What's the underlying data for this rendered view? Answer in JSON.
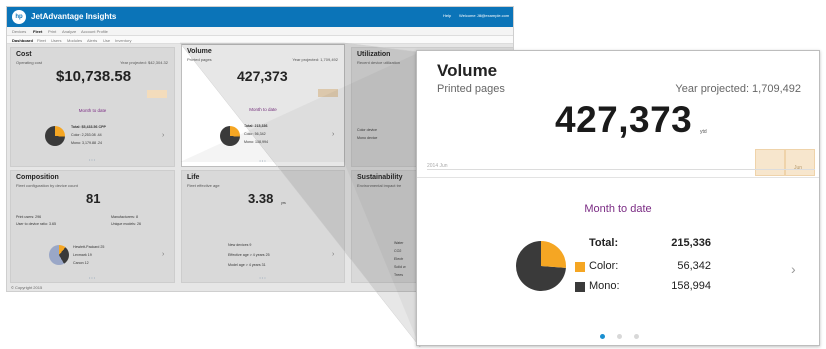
{
  "app": {
    "title": "JetAdvantage Insights",
    "logo_text": "hp",
    "help_label": "Help",
    "user_label": "Welcome Jill@example.com"
  },
  "nav": {
    "tabs": [
      "Devices",
      "Fleet",
      "Print",
      "Analyze",
      "Account Profile"
    ],
    "active_tab": "Fleet",
    "subtabs": [
      "Dashboard",
      "Fleet",
      "Users",
      "Modules",
      "Alerts",
      "Use",
      "Inventory"
    ],
    "active_subtab": "Dashboard"
  },
  "tiles": {
    "cost": {
      "title": "Cost",
      "subtitle": "Operating cost",
      "projected": "Year projected: $42,304.32",
      "value": "$10,738.58",
      "mtd": "Month to date",
      "total": "Total: $5,433.56 CPP",
      "color": "Color: 2,253.08 .44",
      "mono": "Mono: 3,179.88 .24"
    },
    "volume": {
      "title": "Volume",
      "subtitle": "Printed pages",
      "projected": "Year projected: 1,709,492",
      "value": "427,373",
      "mtd": "Month to date",
      "total": "Total: 215,336",
      "color": "Color: 56,342",
      "mono": "Mono: 158,994"
    },
    "utilization": {
      "title": "Utilization",
      "subtitle": "Recent device utilization",
      "r1": "Color device",
      "r2": "Mono device"
    },
    "composition": {
      "title": "Composition",
      "subtitle": "Fleet configuration by device count",
      "value": "81",
      "print_users": "Print users: 296",
      "manufacturers": "Manufacturers: 8",
      "ratio": "User to device ratio: 3.65",
      "models": "Unique models: 26",
      "legend": [
        "Hewlett-Packard 25",
        "Lexmark 19",
        "Canon 12"
      ]
    },
    "life": {
      "title": "Life",
      "subtitle": "Fleet effective age",
      "value": "3.38",
      "unit": "yrs",
      "rows": [
        "New devices 9",
        "Effective age > 4 years 25",
        "Model age > 4 years 31"
      ]
    },
    "sustainability": {
      "title": "Sustainability",
      "subtitle": "Environmental impact tre",
      "rows": [
        "Water",
        "CO2",
        "Electr",
        "Solid w",
        "Trees"
      ]
    }
  },
  "footer": "© Copyright 2015",
  "zoom": {
    "title": "Volume",
    "subtitle": "Printed pages",
    "projected": "Year projected: 1,709,492",
    "value": "427,373",
    "value_unit": "ytd",
    "axis_label_start": "2014 Jun",
    "axis_label_end": "Jun",
    "mtd_label": "Month to date",
    "total_label": "Total:",
    "total_value": "215,336",
    "color_label": "Color:",
    "color_value": "56,342",
    "mono_label": "Mono:",
    "mono_value": "158,994",
    "pie": {
      "color_pages": 56342,
      "mono_pages": 158994
    },
    "carousel": {
      "pages": 3,
      "active": 1
    }
  },
  "colors": {
    "brand_blue": "#0b74b8",
    "accent_purple": "#7b2c84",
    "color_series": "#f5a623",
    "mono_series": "#3a3a3a",
    "bar_fill": "#f7e6cd"
  }
}
